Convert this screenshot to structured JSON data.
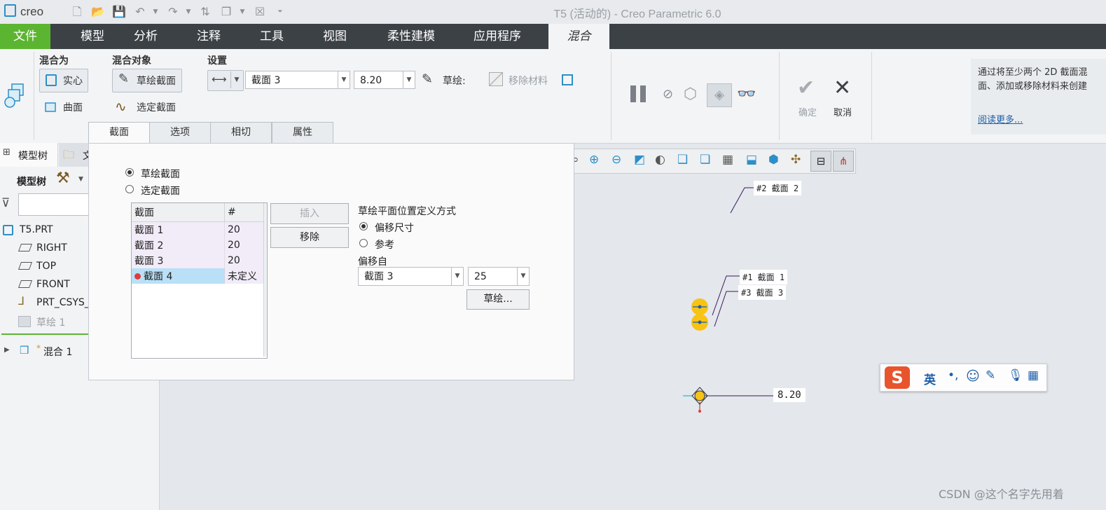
{
  "app": {
    "logo_text": "creo",
    "window_title": "T5 (活动的) - Creo Parametric 6.0"
  },
  "ribbon_tabs": [
    "文件",
    "模型",
    "分析",
    "注释",
    "工具",
    "视图",
    "柔性建模",
    "应用程序",
    "混合"
  ],
  "ribbon": {
    "blend_as_label": "混合为",
    "solid_label": "实心",
    "surface_label": "曲面",
    "blend_obj_label": "混合对象",
    "sketch_section_label": "草绘截面",
    "select_section_label": "选定截面",
    "settings_label": "设置",
    "section_value": "截面 3",
    "offset_value": "8.20",
    "sketch_label": "草绘:",
    "remove_material_label": "移除材料",
    "ok_label": "确定",
    "cancel_label": "取消",
    "help_text": "通过将至少两个 2D 截面混\n面、添加或移除材料来创建",
    "read_more": "阅读更多..."
  },
  "dialog_tabs": [
    "截面",
    "选项",
    "相切",
    "属性"
  ],
  "left_panel": {
    "tab_model_tree": "模型树",
    "tab_file_partial": "文",
    "toolbar_label": "模型树",
    "items": [
      {
        "label": "T5.PRT",
        "icon": "part-icon"
      },
      {
        "label": "RIGHT",
        "icon": "datum-plane-icon"
      },
      {
        "label": "TOP",
        "icon": "datum-plane-icon"
      },
      {
        "label": "FRONT",
        "icon": "datum-plane-icon"
      },
      {
        "label": "PRT_CSYS_",
        "icon": "csys-icon"
      },
      {
        "label": "草绘 1",
        "icon": "sketch-icon"
      },
      {
        "label": "混合 1",
        "icon": "blend-icon"
      }
    ]
  },
  "dialog": {
    "radio_sketch": "草绘截面",
    "radio_select": "选定截面",
    "table_headers": [
      "截面",
      "#"
    ],
    "rows": [
      {
        "name": "截面 1",
        "num": "20"
      },
      {
        "name": "截面 2",
        "num": "20"
      },
      {
        "name": "截面 3",
        "num": "20"
      },
      {
        "name": "截面 4",
        "num": "未定义"
      }
    ],
    "insert_label": "插入",
    "remove_label": "移除",
    "placement_title": "草绘平面位置定义方式",
    "radio_offset": "偏移尺寸",
    "radio_reference": "参考",
    "offset_from_label": "偏移自",
    "offset_from_value": "截面 3",
    "offset_distance": "25",
    "sketch_button": "草绘..."
  },
  "canvas": {
    "label_2": "#2 截面 2",
    "label_1": "#1 截面 1",
    "label_3": "#3 截面 3",
    "dim_value": "8.20",
    "ime_text": "英",
    "watermark": "CSDN @这个名字先用着"
  },
  "colors": {
    "file_tab": "#5cb531",
    "tab_bar": "#3c4146",
    "selection": "#b9e0f7",
    "marker_yellow": "#f7c315"
  }
}
